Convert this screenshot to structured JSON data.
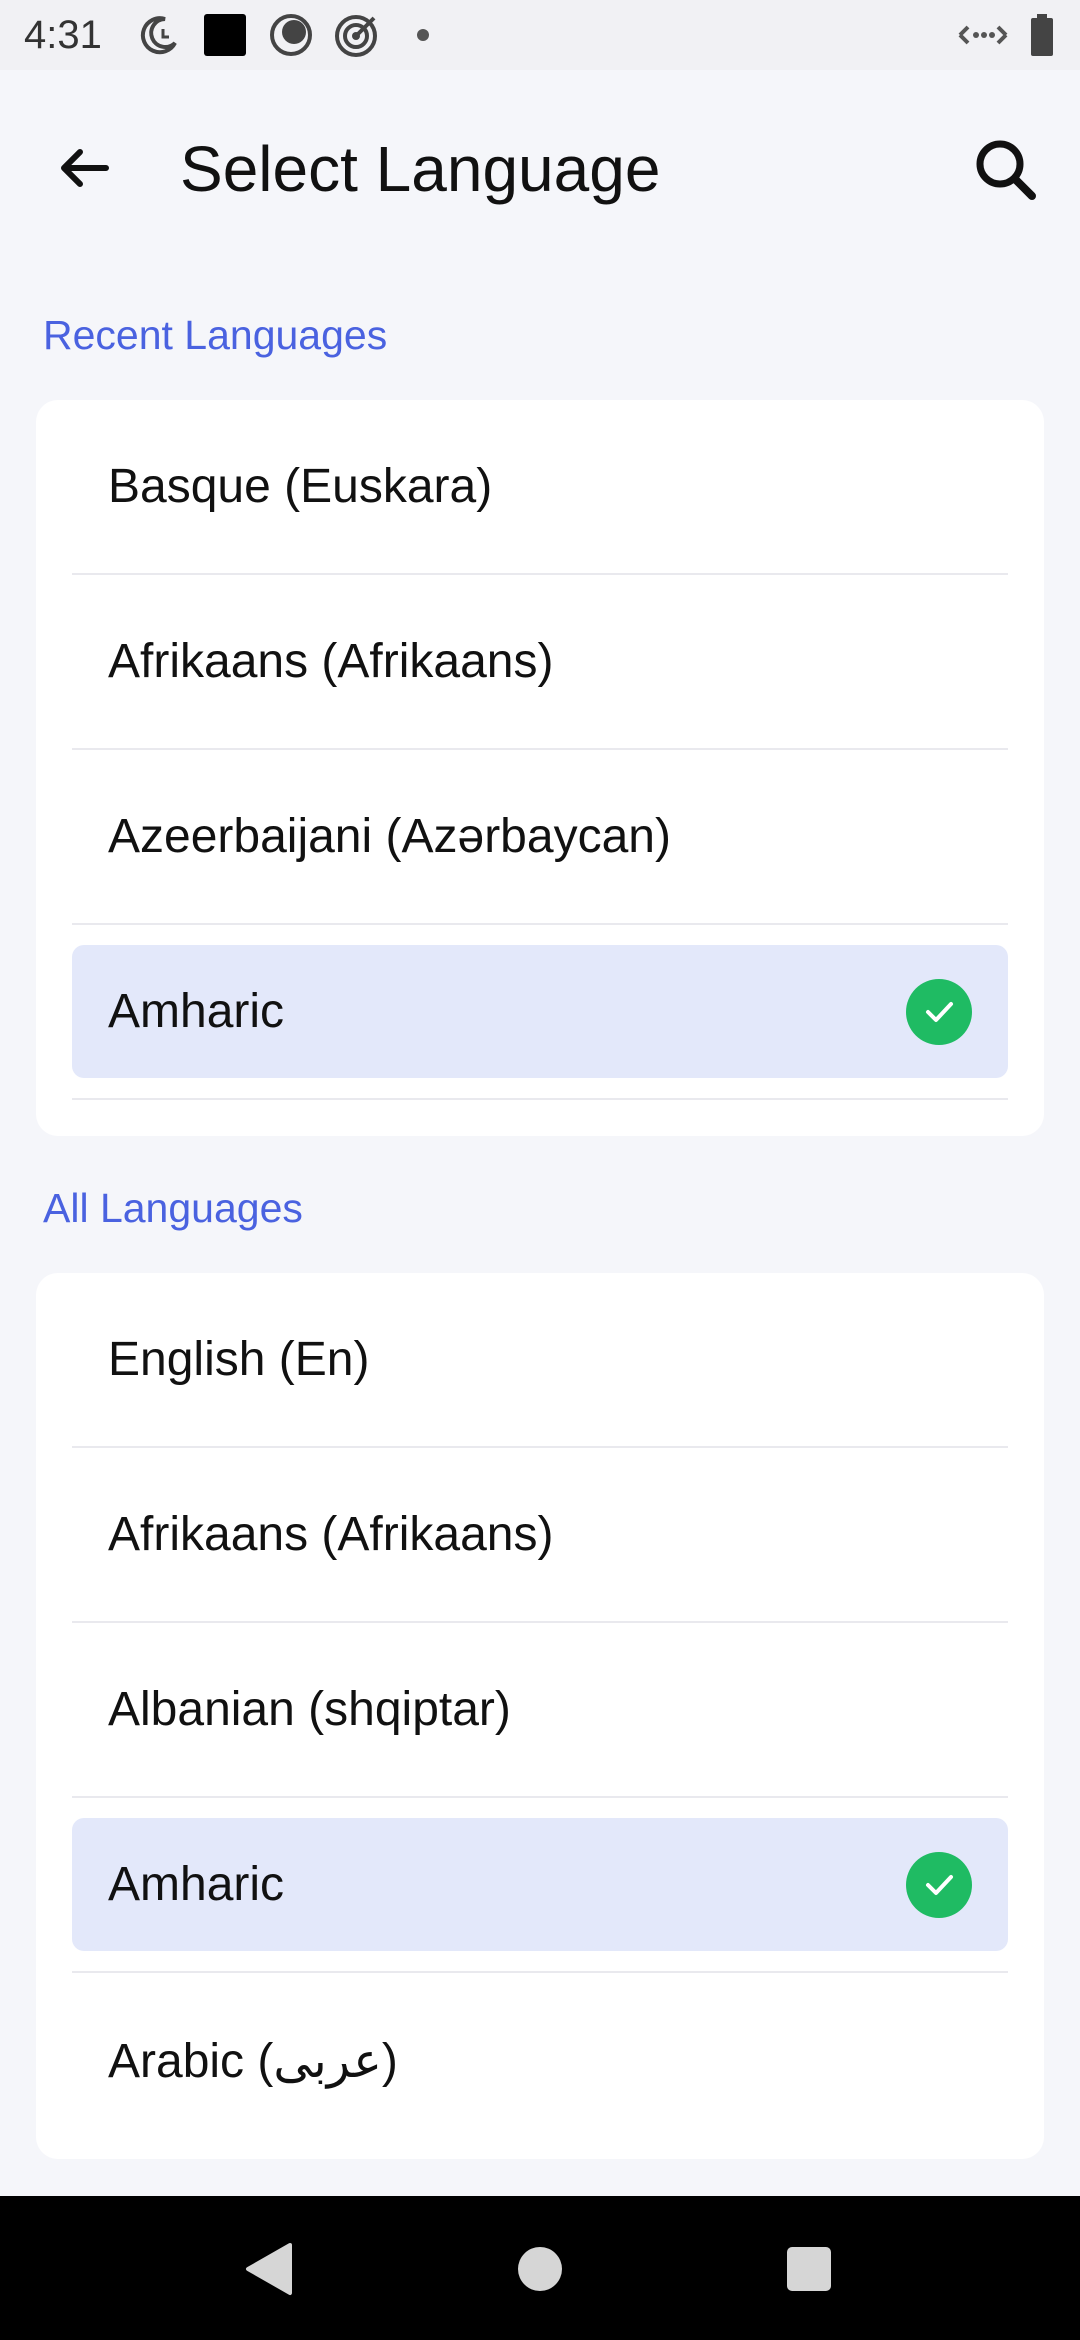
{
  "status_bar": {
    "time": "4:31",
    "icons_left": [
      "moon-clock-icon",
      "square-app-icon",
      "circle-record-icon",
      "target-icon",
      "dot-icon"
    ],
    "icons_right": [
      "data-transfer-icon",
      "battery-icon"
    ]
  },
  "header": {
    "title": "Select Language",
    "back_icon": "arrow-left-icon",
    "search_icon": "search-icon"
  },
  "recent": {
    "label": "Recent Languages",
    "items": [
      {
        "label": "Basque (Euskara)",
        "selected": false
      },
      {
        "label": "Afrikaans (Afrikaans)",
        "selected": false
      },
      {
        "label": "Azeerbaijani (Azərbaycan)",
        "selected": false
      },
      {
        "label": "Amharic",
        "selected": true
      }
    ]
  },
  "all": {
    "label": "All Languages",
    "items": [
      {
        "label": "English (En)",
        "selected": false
      },
      {
        "label": "Afrikaans (Afrikaans)",
        "selected": false
      },
      {
        "label": "Albanian (shqiptar)",
        "selected": false
      },
      {
        "label": "Amharic",
        "selected": true
      },
      {
        "label": "Arabic (عربى)",
        "selected": false
      }
    ]
  },
  "colors": {
    "accent": "#4a62e0",
    "selected_bg": "#e3e8fa",
    "check": "#1fbb63"
  },
  "nav": [
    "back-triangle-icon",
    "home-circle-icon",
    "recents-square-icon"
  ]
}
